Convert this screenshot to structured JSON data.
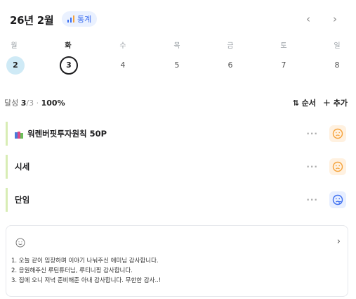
{
  "header": {
    "title": "26년 2월",
    "stats_label": "통계",
    "prev": "‹",
    "next": "›"
  },
  "week": {
    "labels": [
      "월",
      "화",
      "수",
      "목",
      "금",
      "토",
      "일"
    ],
    "days": [
      "2",
      "3",
      "4",
      "5",
      "6",
      "7",
      "8"
    ]
  },
  "summary": {
    "label": "달성",
    "done": "3",
    "total": "/3",
    "percent": "100%",
    "sort_label": "순서",
    "add_label": "추가"
  },
  "tasks": [
    {
      "label": "워렌버핏투자원칙 50P",
      "menu": "···",
      "mood": "frown-icon",
      "color": "#f5a23a"
    },
    {
      "label": "시세",
      "menu": "···",
      "mood": "frown-icon",
      "color": "#f5a23a"
    },
    {
      "label": "단임",
      "menu": "···",
      "mood": "sad-icon",
      "color": "#3a6df0"
    }
  ],
  "memo": {
    "lines": [
      "1. 오늘 같이 임장하며 이야기 나눠주신 애미님 감사합니다.",
      "2. 응원해주신 루틴튜터님, 루티니핑 감사합니다.",
      "3. 집에 오니 저녁 준비해준 아내 감사합니다. 무한한 감사..!"
    ]
  }
}
